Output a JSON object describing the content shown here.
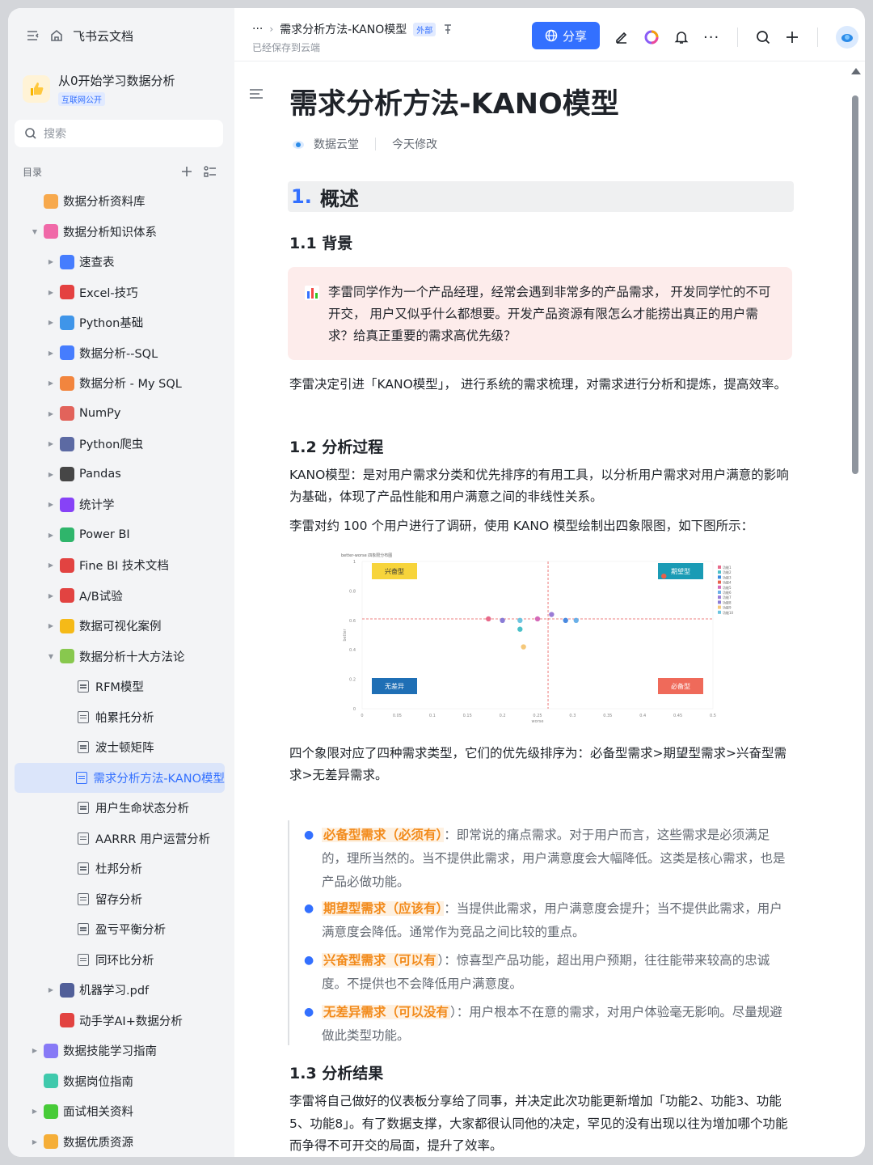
{
  "app": {
    "name": "飞书云文档"
  },
  "kb": {
    "title": "从0开始学习数据分析",
    "tag": "互联网公开"
  },
  "search": {
    "placeholder": "搜索"
  },
  "toc": {
    "label": "目录"
  },
  "tree": [
    {
      "label": "数据分析资料库",
      "level": 0,
      "caret": "",
      "icon": "orange-square-icon",
      "color": "#f7a13b"
    },
    {
      "label": "数据分析知识体系",
      "level": 0,
      "caret": "▼",
      "icon": "pink-square-icon",
      "color": "#f05aa0"
    },
    {
      "label": "速查表",
      "level": 1,
      "caret": "▶",
      "icon": "magnifier-icon",
      "color": "#3370ff"
    },
    {
      "label": "Excel-技巧",
      "level": 1,
      "caret": "▶",
      "icon": "hundred-icon",
      "color": "#e22d2d"
    },
    {
      "label": "Python基础",
      "level": 1,
      "caret": "▶",
      "icon": "monitor-icon",
      "color": "#2b8be8"
    },
    {
      "label": "数据分析--SQL",
      "level": 1,
      "caret": "▶",
      "icon": "bar-chart-icon",
      "color": "#3370ff"
    },
    {
      "label": "数据分析 - My SQL",
      "level": 1,
      "caret": "▶",
      "icon": "rainbow-icon",
      "color": "#f2792a"
    },
    {
      "label": "NumPy",
      "level": 1,
      "caret": "▶",
      "icon": "memo-icon",
      "color": "#e0534a"
    },
    {
      "label": "Python爬虫",
      "level": 1,
      "caret": "▶",
      "icon": "spider-icon",
      "color": "#4b5b9a"
    },
    {
      "label": "Pandas",
      "level": 1,
      "caret": "▶",
      "icon": "panda-icon",
      "color": "#333333"
    },
    {
      "label": "统计学",
      "level": 1,
      "caret": "▶",
      "icon": "floppy-icon",
      "color": "#7b2ff7"
    },
    {
      "label": "Power BI",
      "level": 1,
      "caret": "▶",
      "icon": "recycle-icon",
      "color": "#1aae5c"
    },
    {
      "label": "Fine BI 技术文档",
      "level": 1,
      "caret": "▶",
      "icon": "pin-icon",
      "color": "#e0302d"
    },
    {
      "label": "A/B试验",
      "level": 1,
      "caret": "▶",
      "icon": "ab-icon",
      "color": "#e0302d"
    },
    {
      "label": "数据可视化案例",
      "level": 1,
      "caret": "▶",
      "icon": "medal-icon",
      "color": "#f5b400"
    },
    {
      "label": "数据分析十大方法论",
      "level": 1,
      "caret": "▼",
      "icon": "puzzle-icon",
      "color": "#7cc33c"
    },
    {
      "label": "RFM模型",
      "level": 2,
      "caret": "",
      "icon": "doc-icon",
      "color": ""
    },
    {
      "label": "帕累托分析",
      "level": 2,
      "caret": "",
      "icon": "doc-icon",
      "color": ""
    },
    {
      "label": "波士顿矩阵",
      "level": 2,
      "caret": "",
      "icon": "doc-icon",
      "color": ""
    },
    {
      "label": "需求分析方法-KANO模型",
      "level": 2,
      "caret": "",
      "icon": "doc-icon",
      "color": "",
      "active": true
    },
    {
      "label": "用户生命状态分析",
      "level": 2,
      "caret": "",
      "icon": "doc-icon",
      "color": ""
    },
    {
      "label": "AARRR 用户运营分析",
      "level": 2,
      "caret": "",
      "icon": "doc-icon",
      "color": ""
    },
    {
      "label": "杜邦分析",
      "level": 2,
      "caret": "",
      "icon": "doc-icon",
      "color": ""
    },
    {
      "label": "留存分析",
      "level": 2,
      "caret": "",
      "icon": "doc-icon",
      "color": ""
    },
    {
      "label": "盈亏平衡分析",
      "level": 2,
      "caret": "",
      "icon": "doc-icon",
      "color": ""
    },
    {
      "label": "同环比分析",
      "level": 2,
      "caret": "",
      "icon": "doc-icon",
      "color": ""
    },
    {
      "label": "机器学习.pdf",
      "level": 1,
      "caret": "▶",
      "icon": "robot-icon",
      "color": "#3f4f8f"
    },
    {
      "label": "动手学AI+数据分析",
      "level": 1,
      "caret": "",
      "icon": "thermometer-icon",
      "color": "#e0302d"
    },
    {
      "label": "数据技能学习指南",
      "level": 0,
      "caret": "▶",
      "icon": "purple-square-icon",
      "color": "#7b6cf6"
    },
    {
      "label": "数据岗位指南",
      "level": 0,
      "caret": "",
      "icon": "teal-square-icon",
      "color": "#2bc4a4"
    },
    {
      "label": "面试相关资料",
      "level": 0,
      "caret": "▶",
      "icon": "green-square-icon",
      "color": "#34c724"
    },
    {
      "label": "数据优质资源",
      "level": 0,
      "caret": "▶",
      "icon": "flame-icon",
      "color": "#f5a623"
    }
  ],
  "header": {
    "ellipsis": "···",
    "doc_title": "需求分析方法-KANO模型",
    "tag": "外部",
    "saved": "已经保存到云端",
    "share": "分享"
  },
  "doc": {
    "title": "需求分析方法-KANO模型",
    "author": "数据云堂",
    "modified": "今天修改",
    "h1_num": "1.",
    "h1": "概述",
    "h2_1": "1.1 背景",
    "callout": "李雷同学作为一个产品经理，经常会遇到非常多的产品需求， 开发同学忙的不可开交， 用户又似乎什么都想要。开发产品资源有限怎么才能捞出真正的用户需求？给真正重要的需求高优先级？",
    "p1": "李雷决定引进「KANO模型」， 进行系统的需求梳理，对需求进行分析和提炼，提高效率。",
    "h2_2": "1.2 分析过程",
    "p2": "KANO模型：是对用户需求分类和优先排序的有用工具，以分析用户需求对用户满意的影响为基础，体现了产品性能和用户满意之间的非线性关系。",
    "p3": "李雷对约 100 个用户进行了调研，使用 KANO 模型绘制出四象限图，如下图所示：",
    "p4": "四个象限对应了四种需求类型，它们的优先级排序为：必备型需求>期望型需求>兴奋型需求>无差异需求。",
    "bullets": [
      {
        "hl": "必备型需求（必须有）",
        "text": "：即常说的痛点需求。对于用户而言，这些需求是必须满足的，理所当然的。当不提供此需求，用户满意度会大幅降低。这类是核心需求，也是产品必做功能。"
      },
      {
        "hl": "期望型需求（应该有）",
        "text": "：当提供此需求，用户满意度会提升；当不提供此需求，用户满意度会降低。通常作为竞品之间比较的重点。"
      },
      {
        "hl": "兴奋型需求（可以有",
        "text": "）：惊喜型产品功能，超出用户预期，往往能带来较高的忠诚度。不提供也不会降低用户满意度。"
      },
      {
        "hl": "无差异需求（可以没有",
        "text": "）：用户根本不在意的需求，对用户体验毫无影响。尽量规避做此类型功能。"
      }
    ],
    "h2_3": "1.3 分析结果",
    "p5": "李雷将自己做好的仪表板分享给了同事，并决定此次功能更新增加「功能2、功能3、功能5、功能8」。有了数据支撑，大家都很认同他的决定，罕见的没有出现以往为增加哪个功能而争得不可开交的局面，提升了效率。"
  },
  "chart_data": {
    "type": "scatter",
    "title": "better-worse 四象限分布图",
    "xlabel": "worse",
    "ylabel": "better",
    "xlim": [
      0,
      0.5
    ],
    "ylim": [
      0,
      1
    ],
    "xticks": [
      "0",
      "0.05",
      "0.1",
      "0.15",
      "0.2",
      "0.25",
      "0.3",
      "0.35",
      "0.4",
      "0.45",
      "0.5"
    ],
    "yticks": [
      "0",
      "0.2",
      "0.4",
      "0.6",
      "0.8",
      "1"
    ],
    "quadrants": [
      {
        "label": "兴奋型",
        "color": "#f7d43b",
        "text_color": "#333333",
        "corner": "top-left"
      },
      {
        "label": "期望型",
        "color": "#1a9bb5",
        "text_color": "#ffffff",
        "corner": "top-right"
      },
      {
        "label": "无差异",
        "color": "#1f6fb5",
        "text_color": "#ffffff",
        "corner": "bottom-left"
      },
      {
        "label": "必备型",
        "color": "#ef6a5a",
        "text_color": "#ffffff",
        "corner": "bottom-right"
      }
    ],
    "ref_x": 0.265,
    "ref_y": 0.61,
    "points": [
      {
        "x": 0.18,
        "y": 0.61,
        "color": "#e86a8a"
      },
      {
        "x": 0.2,
        "y": 0.6,
        "color": "#8a7cd6"
      },
      {
        "x": 0.225,
        "y": 0.6,
        "color": "#6cc4e0"
      },
      {
        "x": 0.225,
        "y": 0.54,
        "color": "#4ac0c8"
      },
      {
        "x": 0.25,
        "y": 0.61,
        "color": "#d46ab8"
      },
      {
        "x": 0.27,
        "y": 0.64,
        "color": "#9a7cd6"
      },
      {
        "x": 0.29,
        "y": 0.6,
        "color": "#4a8ae0"
      },
      {
        "x": 0.305,
        "y": 0.6,
        "color": "#6ab0e8"
      },
      {
        "x": 0.23,
        "y": 0.42,
        "color": "#f5c87a"
      },
      {
        "x": 0.43,
        "y": 0.9,
        "color": "#e8604a"
      }
    ],
    "legend": [
      "功能1",
      "功能2",
      "功能3",
      "功能4",
      "功能5",
      "功能6",
      "功能7",
      "功能8",
      "功能9",
      "功能10"
    ],
    "legend_colors": [
      "#e86a8a",
      "#4ac0c8",
      "#3a8ae0",
      "#e8604a",
      "#d46ab8",
      "#6ab0e8",
      "#9a7cd6",
      "#8a7cd6",
      "#f5c87a",
      "#6cc4e0"
    ]
  }
}
